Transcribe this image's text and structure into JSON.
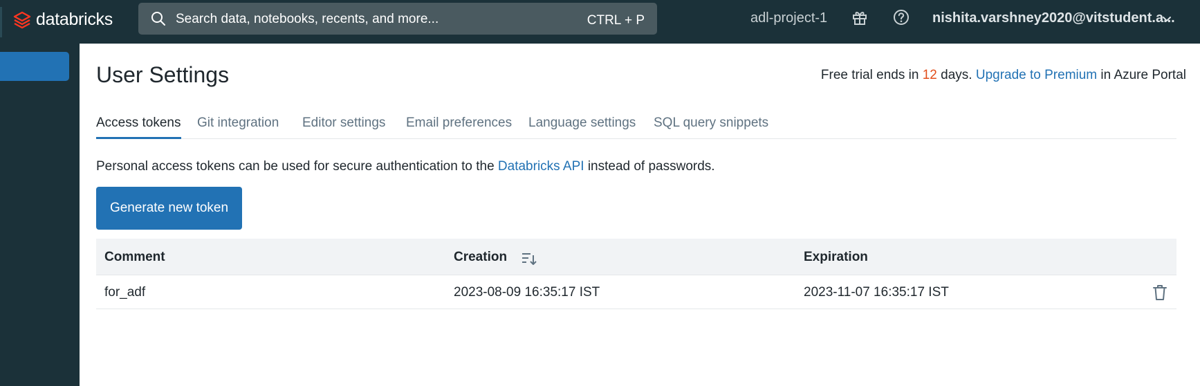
{
  "app": {
    "brand": "databricks"
  },
  "search": {
    "placeholder": "Search data, notebooks, recents, and more...",
    "shortcut": "CTRL + P"
  },
  "header": {
    "workspace": "adl-project-1",
    "user": "nishita.varshney2020@vitstudent.a..."
  },
  "page": {
    "title": "User Settings"
  },
  "trial": {
    "prefix": "Free trial ends in",
    "days": "12",
    "middle": "days.",
    "link": "Upgrade to Premium",
    "suffix": "in Azure Portal"
  },
  "tabs": [
    {
      "label": "Access tokens",
      "active": true
    },
    {
      "label": "Git integration"
    },
    {
      "label": "Editor settings"
    },
    {
      "label": "Email preferences"
    },
    {
      "label": "Language settings"
    },
    {
      "label": "SQL query snippets"
    }
  ],
  "description": {
    "before": "Personal access tokens can be used for secure authentication to the",
    "link": "Databricks API",
    "after": "instead of passwords."
  },
  "buttons": {
    "generate": "Generate new token"
  },
  "table": {
    "columns": [
      "Comment",
      "Creation",
      "Expiration"
    ],
    "rows": [
      {
        "comment": "for_adf",
        "creation": "2023-08-09 16:35:17 IST",
        "expiration": "2023-11-07 16:35:17 IST"
      }
    ]
  },
  "colors": {
    "topbar": "#1b3139",
    "accent": "#2272b4",
    "logo": "#ff3621",
    "trial_days": "#e24e1b"
  }
}
